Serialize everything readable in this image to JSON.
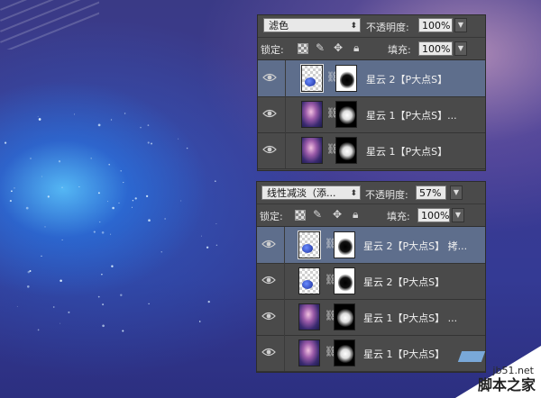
{
  "panel1": {
    "blend_mode": "滤色",
    "opacity_label": "不透明度:",
    "opacity_value": "100%",
    "lock_label": "锁定:",
    "fill_label": "填充:",
    "fill_value": "100%",
    "layers": [
      {
        "name": "星云 2【P大点S】",
        "thumb": "checker",
        "mask": "light",
        "selected": true
      },
      {
        "name": "星云 1【P大点S】...",
        "thumb": "nebula",
        "mask": "dark",
        "selected": false
      },
      {
        "name": "星云 1【P大点S】",
        "thumb": "nebula",
        "mask": "dark",
        "selected": false
      }
    ]
  },
  "panel2": {
    "blend_mode": "线性减淡（添...",
    "opacity_label": "不透明度:",
    "opacity_value": "57%",
    "lock_label": "锁定:",
    "fill_label": "填充:",
    "fill_value": "100%",
    "layers": [
      {
        "name": "星云 2【P大点S】 拷...",
        "thumb": "checker",
        "mask": "light",
        "selected": true
      },
      {
        "name": "星云 2【P大点S】",
        "thumb": "checker",
        "mask": "light",
        "selected": false
      },
      {
        "name": "星云 1【P大点S】 ...",
        "thumb": "nebula",
        "mask": "dark",
        "selected": false
      },
      {
        "name": "星云 1【P大点S】",
        "thumb": "nebula",
        "mask": "dark",
        "selected": false
      }
    ]
  },
  "watermark": {
    "url": "jb51.net",
    "text": "脚本之家"
  },
  "icons": {
    "lock_transparent": "checkerboard-icon",
    "lock_paint": "brush-icon",
    "lock_move": "move-icon",
    "lock_all": "padlock-icon",
    "visibility": "eye-icon",
    "link": "chain-link-icon"
  }
}
